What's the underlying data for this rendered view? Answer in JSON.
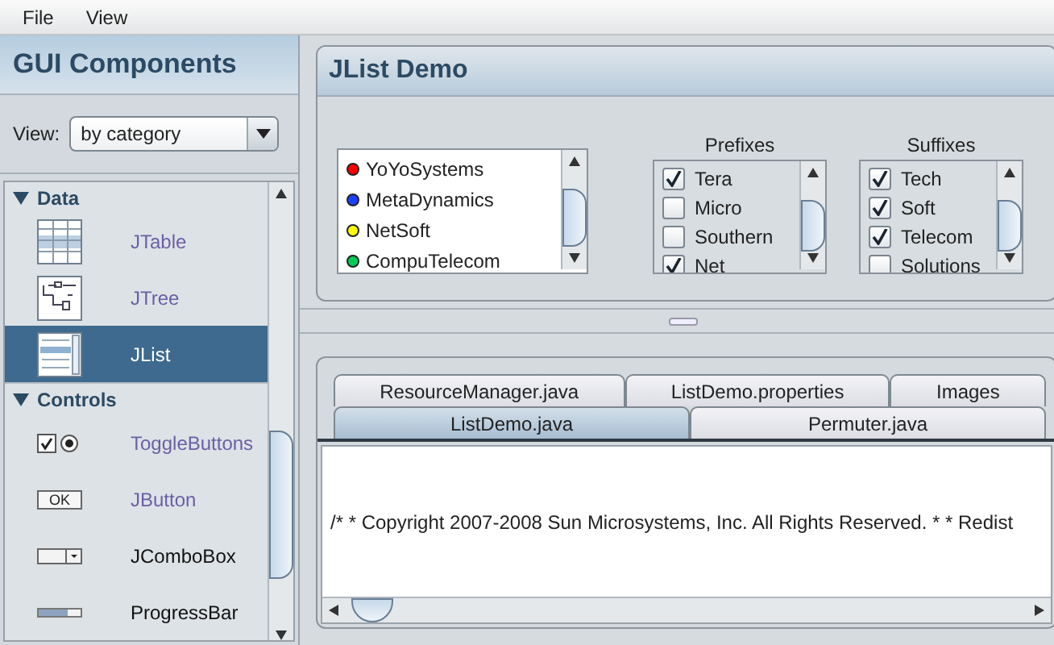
{
  "menu": [
    "File",
    "View"
  ],
  "sidebar": {
    "title": "GUI Components",
    "view_label": "View:",
    "view_value": "by category",
    "categories": [
      {
        "name": "Data",
        "expanded": true,
        "children": [
          {
            "label": "JTable",
            "kind": "table",
            "visited": true,
            "selected": false
          },
          {
            "label": "JTree",
            "kind": "tree",
            "visited": true,
            "selected": false
          },
          {
            "label": "JList",
            "kind": "list",
            "visited": true,
            "selected": true
          }
        ]
      },
      {
        "name": "Controls",
        "expanded": true,
        "children": [
          {
            "label": "ToggleButtons",
            "kind": "toggle",
            "visited": true,
            "selected": false
          },
          {
            "label": "JButton",
            "kind": "button",
            "icon_label": "OK",
            "visited": true,
            "selected": false
          },
          {
            "label": "JComboBox",
            "kind": "combo",
            "visited": false,
            "selected": false
          },
          {
            "label": "ProgressBar",
            "kind": "progress",
            "visited": false,
            "selected": false
          }
        ]
      }
    ]
  },
  "demo": {
    "title": "JList Demo",
    "companies": [
      {
        "name": "YoYoSystems",
        "color": "#ff0000"
      },
      {
        "name": "MetaDynamics",
        "color": "#1f3fff"
      },
      {
        "name": "NetSoft",
        "color": "#ffff00"
      },
      {
        "name": "CompuTelecom",
        "color": "#00cc55"
      }
    ],
    "groups": [
      {
        "title": "Prefixes",
        "items": [
          {
            "label": "Tera",
            "checked": true
          },
          {
            "label": "Micro",
            "checked": false
          },
          {
            "label": "Southern",
            "checked": false
          },
          {
            "label": "Net",
            "checked": true
          }
        ]
      },
      {
        "title": "Suffixes",
        "items": [
          {
            "label": "Tech",
            "checked": true
          },
          {
            "label": "Soft",
            "checked": true
          },
          {
            "label": "Telecom",
            "checked": true
          },
          {
            "label": "Solutions",
            "checked": false
          }
        ]
      }
    ]
  },
  "source": {
    "tab_rows": [
      [
        {
          "label": "ResourceManager.java",
          "selected": false
        },
        {
          "label": "ListDemo.properties",
          "selected": false
        },
        {
          "label": "Images",
          "selected": false
        }
      ],
      [
        {
          "label": "ListDemo.java",
          "selected": true
        },
        {
          "label": "Permuter.java",
          "selected": false
        }
      ]
    ],
    "text": "/* * Copyright 2007-2008 Sun Microsystems, Inc. All Rights Reserved. * * Redist"
  }
}
